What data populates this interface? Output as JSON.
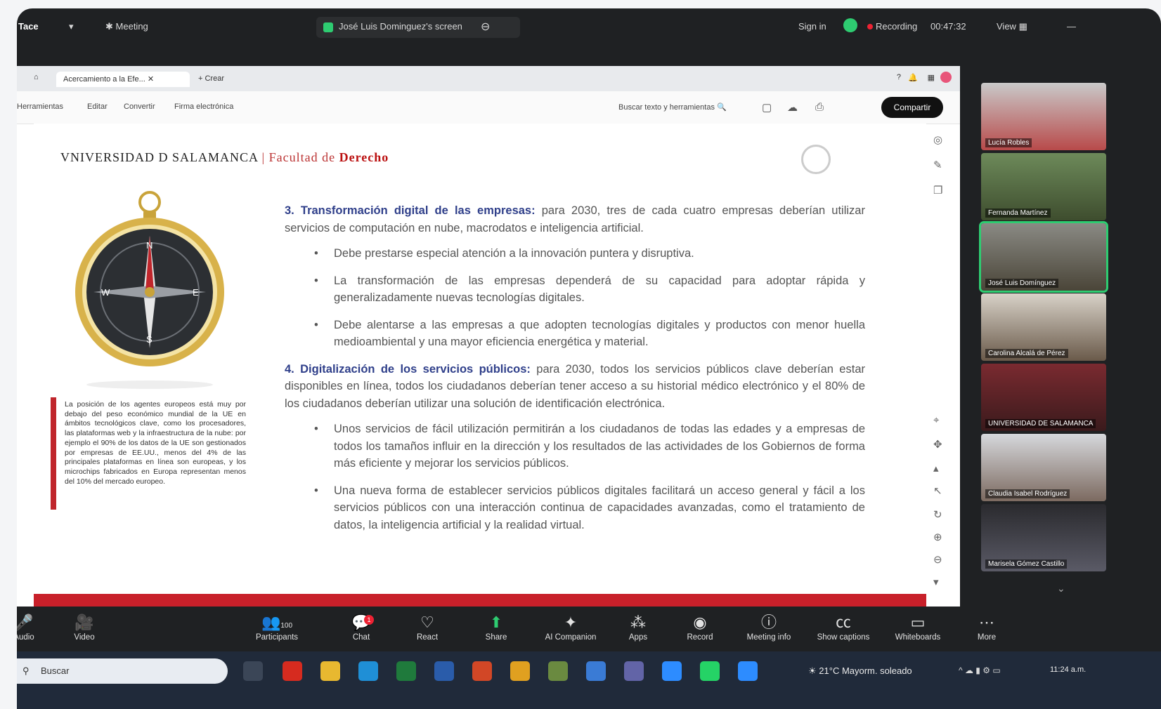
{
  "topbar": {
    "app_fragment": "Tace",
    "meeting_label": "Meeting",
    "sharing_label": "José Luis Dominguez's screen",
    "sign_in": "Sign in",
    "recording": "Recording",
    "timer": "00:47:32",
    "view": "View"
  },
  "browser": {
    "tab_title": "Acercamiento a la Efe...",
    "new_tab": "+ Crear",
    "menu": [
      "Herramientas",
      "Editar",
      "Convertir",
      "Firma electrónica"
    ],
    "search": "Buscar texto y herramientas",
    "share_button": "Compartir"
  },
  "slide": {
    "univ": "VNIVERSIDAD D SALAMANCA",
    "sep": " | ",
    "faculty": "Facultad de ",
    "faculty_bold": "Derecho",
    "p1_head": "3. Transformación digital de las empresas:",
    "p1_text": " para 2030, tres de cada cuatro empresas deberían utilizar servicios de computación en nube, macrodatos e inteligencia artificial.",
    "b1": "Debe prestarse especial atención a la innovación puntera y disruptiva.",
    "b2": "La transformación de las empresas dependerá de su capacidad para adoptar rápida y generalizadamente nuevas tecnologías digitales.",
    "b3": "Debe alentarse a las empresas a que adopten tecnologías digitales y productos con menor huella medioambiental y una mayor eficiencia energética y material.",
    "p2_head": "4. Digitalización de los servicios públicos:",
    "p2_text": " para 2030, todos los servicios públicos clave deberían estar disponibles en línea, todos los ciudadanos deberían tener acceso a su historial médico electrónico y el 80% de los ciudadanos deberían utilizar una solución de identificación electrónica.",
    "b4": "Unos servicios de fácil utilización permitirán a los ciudadanos de todas las edades y a empresas de todos los tamaños influir en la dirección y los resultados de las actividades de los Gobiernos de forma más eficiente y mejorar los servicios públicos.",
    "b5": "Una nueva forma de establecer servicios públicos digitales facilitará un acceso general y fácil a los servicios públicos con una interacción continua de capacidades avanzadas, como el tratamiento de datos, la inteligencia artificial y la realidad virtual.",
    "quote": "La posición de los agentes europeos está muy por debajo del peso económico mundial de la UE en ámbitos tecnológicos clave, como los procesadores, las plataformas web y la infraestructura de la nube: por ejemplo el 90% de los datos de la UE son gestionados por empresas de EE.UU., menos del 4% de las principales plataformas en línea son europeas, y los microchips fabricados en Europa representan menos del 10% del mercado europeo."
  },
  "participants": [
    {
      "name": "Lucía Robles"
    },
    {
      "name": "Fernanda Martínez"
    },
    {
      "name": "José Luis Domínguez"
    },
    {
      "name": "Carolina Alcalá de Pérez"
    },
    {
      "name": "UNIVERSIDAD DE SALAMANCA"
    },
    {
      "name": "Claudia Isabel Rodríguez"
    },
    {
      "name": "Marisela Gómez Castillo"
    }
  ],
  "toolbar": [
    {
      "icon": "mic-icon",
      "label": "Audio"
    },
    {
      "icon": "video-icon",
      "label": "Video"
    },
    {
      "icon": "participants-icon",
      "label": "Participants"
    },
    {
      "icon": "chat-icon",
      "label": "Chat"
    },
    {
      "icon": "react-icon",
      "label": "React"
    },
    {
      "icon": "share-icon",
      "label": "Share"
    },
    {
      "icon": "ai-companion-icon",
      "label": "AI Companion"
    },
    {
      "icon": "apps-icon",
      "label": "Apps"
    },
    {
      "icon": "record-icon",
      "label": "Record"
    },
    {
      "icon": "info-icon",
      "label": "Meeting info"
    },
    {
      "icon": "captions-icon",
      "label": "Show captions"
    },
    {
      "icon": "whiteboard-icon",
      "label": "Whiteboards"
    },
    {
      "icon": "more-icon",
      "label": "More"
    }
  ],
  "participants_count": "100",
  "chat_badge": "1",
  "taskbar": {
    "search": "Buscar",
    "weather": "21°C  Mayorm. soleado",
    "time": "11:24 a.m."
  },
  "colors": {
    "accent_red": "#c8202a",
    "heading_blue": "#2f3f8a",
    "zoom_green": "#2ecc71"
  }
}
